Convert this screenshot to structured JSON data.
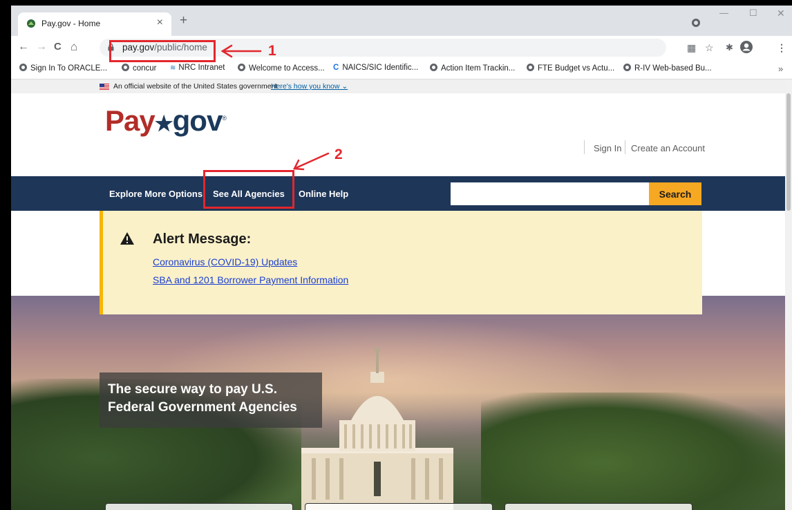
{
  "browser": {
    "tab_title": "Pay.gov - Home",
    "tab_close": "×",
    "new_tab": "+",
    "window_controls": {
      "minimize": "—",
      "maximize": "☐",
      "close": "✕"
    },
    "nav": {
      "back": "←",
      "forward": "→",
      "reload": "C",
      "home": "⌂"
    },
    "url_host": "pay.gov",
    "url_path": "/public/home",
    "bookmarks": [
      {
        "label": "Sign In To ORACLE..."
      },
      {
        "label": "concur"
      },
      {
        "label": "NRC Intranet"
      },
      {
        "label": "Welcome to Access..."
      },
      {
        "label": "NAICS/SIC Identific..."
      },
      {
        "label": "Action Item Trackin..."
      },
      {
        "label": "FTE Budget vs Actu..."
      },
      {
        "label": "R-IV Web-based Bu..."
      }
    ],
    "bookmarks_more": "»"
  },
  "site": {
    "gov_banner_text": "An official website of the United States government",
    "gov_banner_link": "Here's how you know ⌄",
    "logo_pay": "Pay",
    "logo_gov": "gov",
    "logo_reg": "®",
    "sign_in": "Sign In",
    "create_account": "Create an Account",
    "nav": {
      "explore": "Explore More Options",
      "agencies": "See All Agencies",
      "help": "Online Help"
    },
    "search_button": "Search",
    "search_value": "",
    "alert": {
      "title": "Alert Message:",
      "link1": "Coronavirus (COVID-19) Updates",
      "link2": "SBA and 1201 Borrower Payment Information"
    },
    "hero": {
      "line1": "The secure way to pay U.S.",
      "line2": "Federal Government Agencies"
    }
  },
  "annotations": {
    "label1": "1",
    "label2": "2",
    "color": "#e3262d"
  },
  "colors": {
    "nav_bg": "#1e3658",
    "search_btn": "#f7a823",
    "alert_bg": "#fbf1c9",
    "alert_border": "#f7b500",
    "logo_red": "#b22d28"
  }
}
